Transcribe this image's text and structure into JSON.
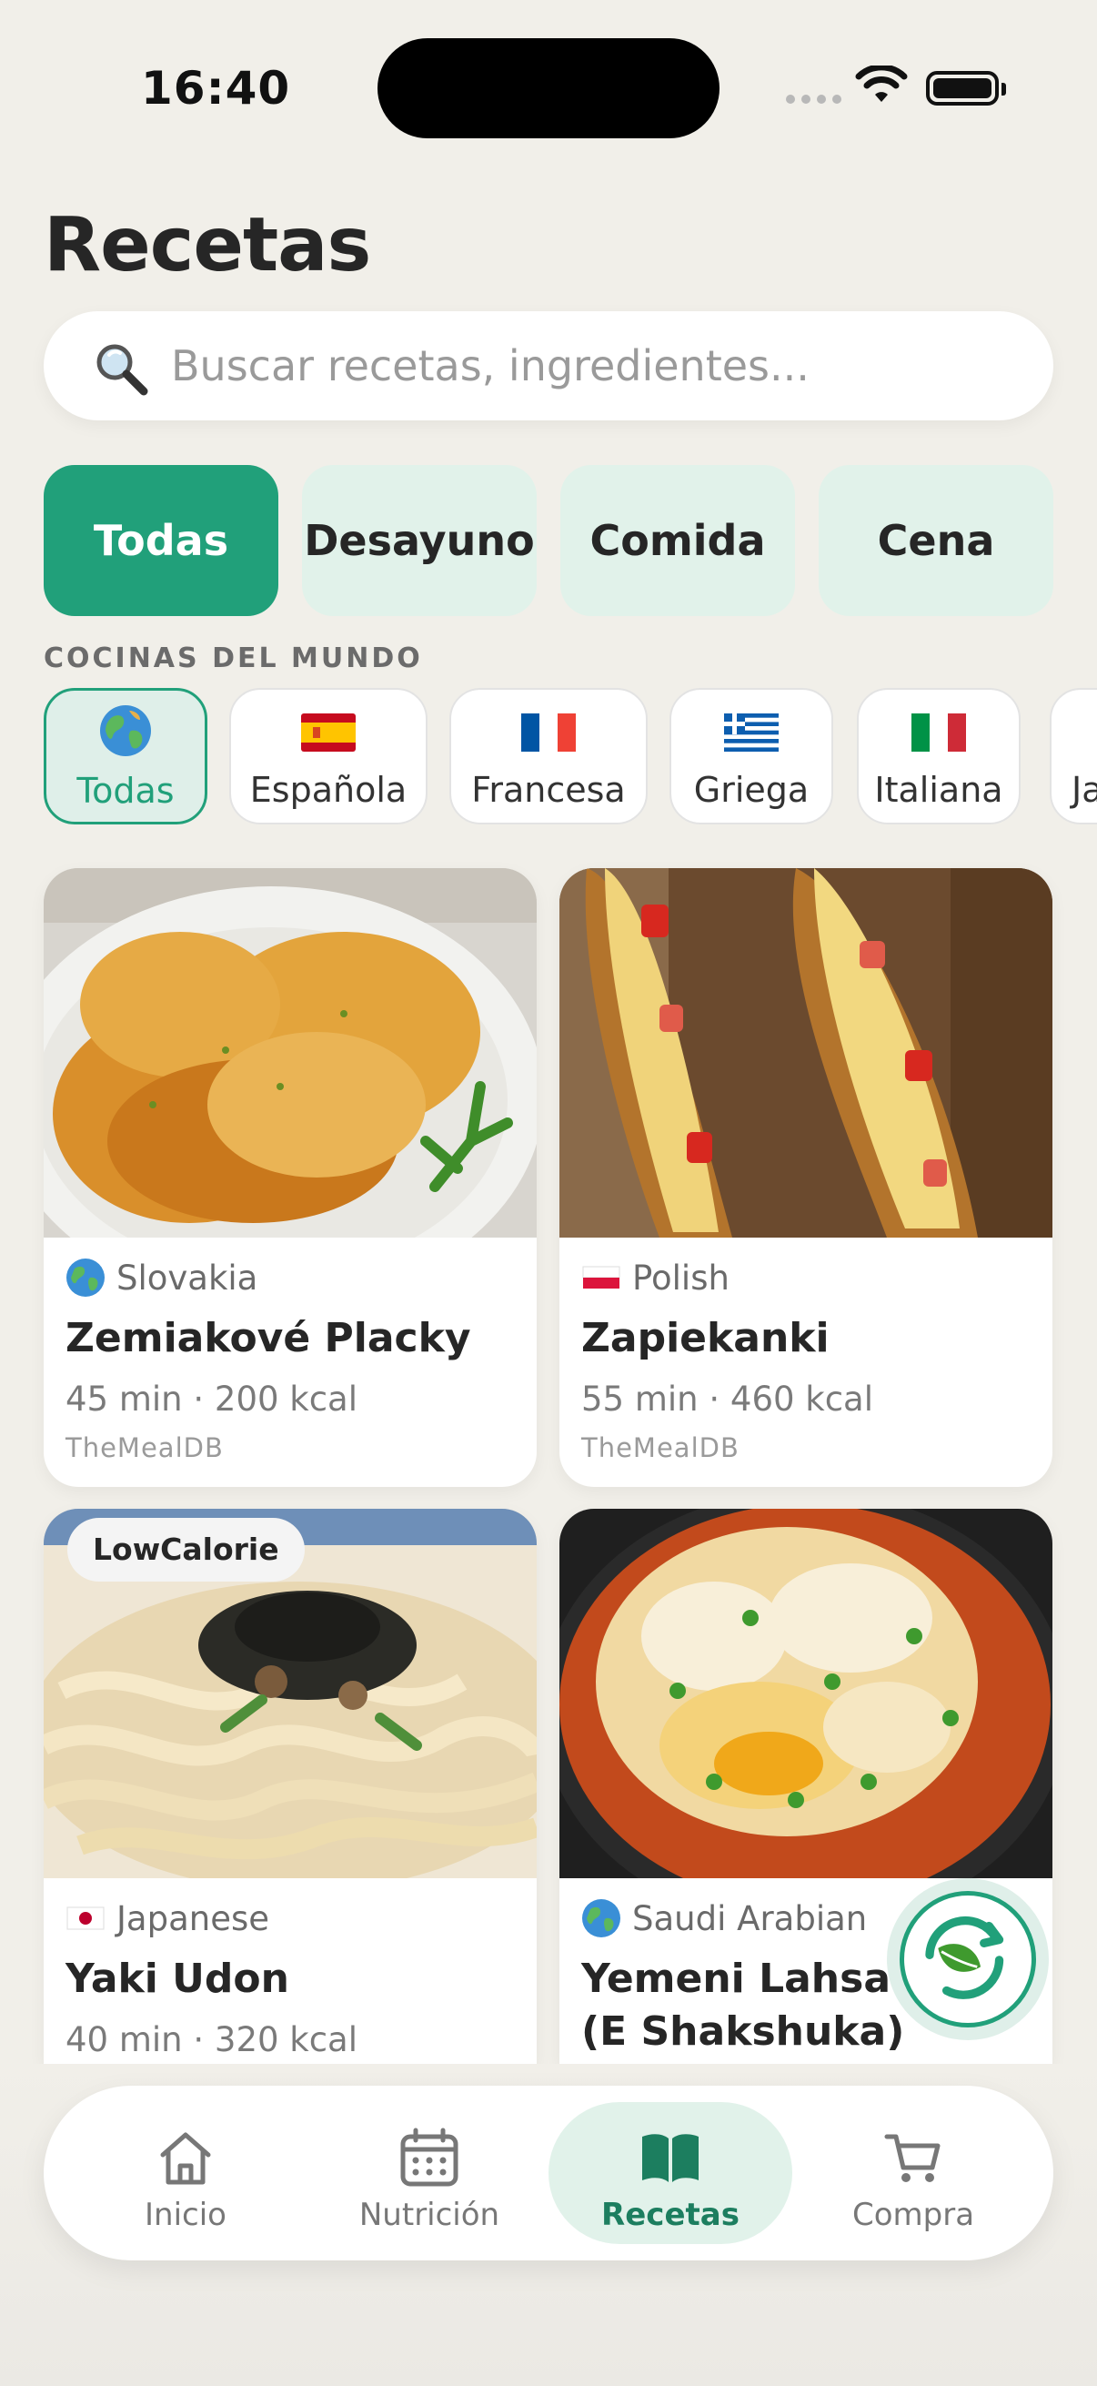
{
  "status_bar": {
    "time": "16:40"
  },
  "header": {
    "title": "Recetas"
  },
  "search": {
    "placeholder": "Buscar recetas, ingredientes..."
  },
  "meal_tabs": [
    {
      "label": "Todas",
      "active": true
    },
    {
      "label": "Desayuno",
      "active": false
    },
    {
      "label": "Comida",
      "active": false
    },
    {
      "label": "Cena",
      "active": false
    }
  ],
  "cuisines": {
    "section_label": "COCINAS DEL MUNDO",
    "items": [
      {
        "label": "Todas",
        "icon": "globe-icon",
        "active": true
      },
      {
        "label": "Española",
        "icon": "spain-flag-icon"
      },
      {
        "label": "Francesa",
        "icon": "france-flag-icon"
      },
      {
        "label": "Griega",
        "icon": "greece-flag-icon"
      },
      {
        "label": "Italiana",
        "icon": "italy-flag-icon"
      },
      {
        "label": "Ja",
        "icon": "japan-flag-icon"
      }
    ]
  },
  "recipes": [
    {
      "origin": "Slovakia",
      "origin_icon": "globe-icon",
      "name": "Zemiakové Placky",
      "meta": "45 min · 200 kcal",
      "source": "TheMealDB"
    },
    {
      "origin": "Polish",
      "origin_icon": "poland-flag-icon",
      "name": "Zapiekanki",
      "meta": "55 min · 460 kcal",
      "source": "TheMealDB"
    },
    {
      "origin": "Japanese",
      "origin_icon": "japan-flag-icon",
      "name": "Yaki Udon",
      "meta": "40 min · 320 kcal",
      "tag": "LowCalorie"
    },
    {
      "origin": "Saudi Arabian",
      "origin_icon": "globe-icon",
      "name": "Yemeni Lahsa (E Shakshuka)"
    }
  ],
  "fab": {
    "icon": "leaf-refresh-icon"
  },
  "bottom_nav": [
    {
      "label": "Inicio",
      "icon": "home-icon"
    },
    {
      "label": "Nutrición",
      "icon": "calendar-icon"
    },
    {
      "label": "Recetas",
      "icon": "book-icon",
      "active": true
    },
    {
      "label": "Compra",
      "icon": "cart-icon"
    }
  ],
  "colors": {
    "accent": "#21a07a",
    "accent_light": "#e1f2ea",
    "background": "#f1efe9"
  }
}
